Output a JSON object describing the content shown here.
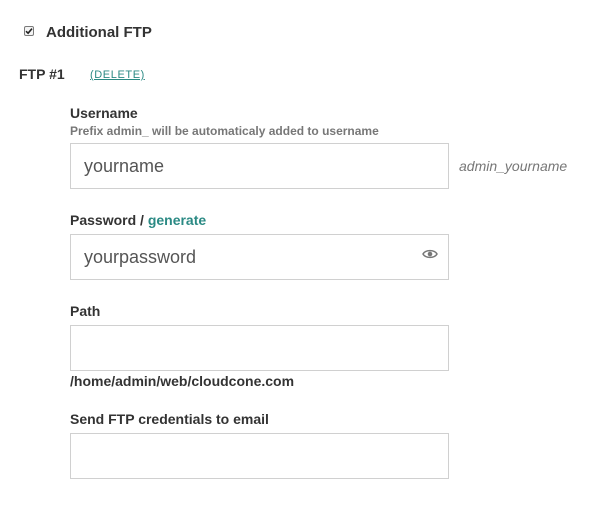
{
  "additional_ftp": {
    "checked": true,
    "label": "Additional FTP"
  },
  "ftp_entry": {
    "title": "FTP #1",
    "delete_label": "(DELETE)",
    "username": {
      "label": "Username",
      "hint": "Prefix admin_ will be automaticaly added to username",
      "value": "yourname",
      "suffix_preview": "admin_yourname"
    },
    "password": {
      "label": "Password /",
      "generate_label": "generate",
      "value": "yourpassword",
      "toggle_icon": "eye-icon"
    },
    "path": {
      "label": "Path",
      "value": "",
      "hint": "/home/admin/web/cloudcone.com"
    },
    "email": {
      "label": "Send FTP credentials to email",
      "value": ""
    }
  },
  "colors": {
    "link": "#2b8a84",
    "text": "#333333",
    "muted": "#777777",
    "input_border": "#d0d0d0"
  }
}
